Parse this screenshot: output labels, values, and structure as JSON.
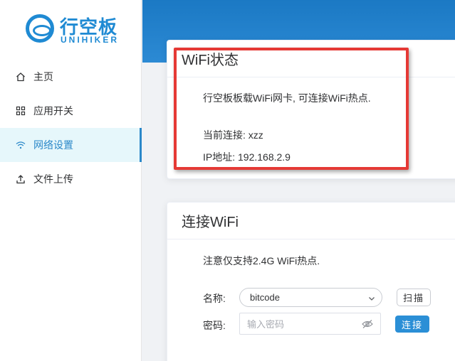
{
  "logo": {
    "cn": "行空板",
    "en": "UNIHIKER"
  },
  "menu": [
    {
      "label": "主页",
      "icon": "home-icon"
    },
    {
      "label": "应用开关",
      "icon": "grid-icon"
    },
    {
      "label": "网络设置",
      "icon": "wifi-icon",
      "active": true
    },
    {
      "label": "文件上传",
      "icon": "upload-icon"
    }
  ],
  "wifi_status": {
    "title": "WiFi状态",
    "desc": "行空板板载WiFi网卡, 可连接WiFi热点.",
    "current": "当前连接: xzz",
    "ip": "IP地址: 192.168.2.9"
  },
  "connect": {
    "title": "连接WiFi",
    "note": "注意仅支持2.4G WiFi热点.",
    "name_label": "名称:",
    "ssid_value": "bitcode",
    "password_label": "密码:",
    "password_placeholder": "输入密码",
    "scan_label": "扫描",
    "connect_label": "连接"
  },
  "colors": {
    "accent": "#2b88c9",
    "highlight": "#e53935",
    "header": "#1b79c4"
  }
}
